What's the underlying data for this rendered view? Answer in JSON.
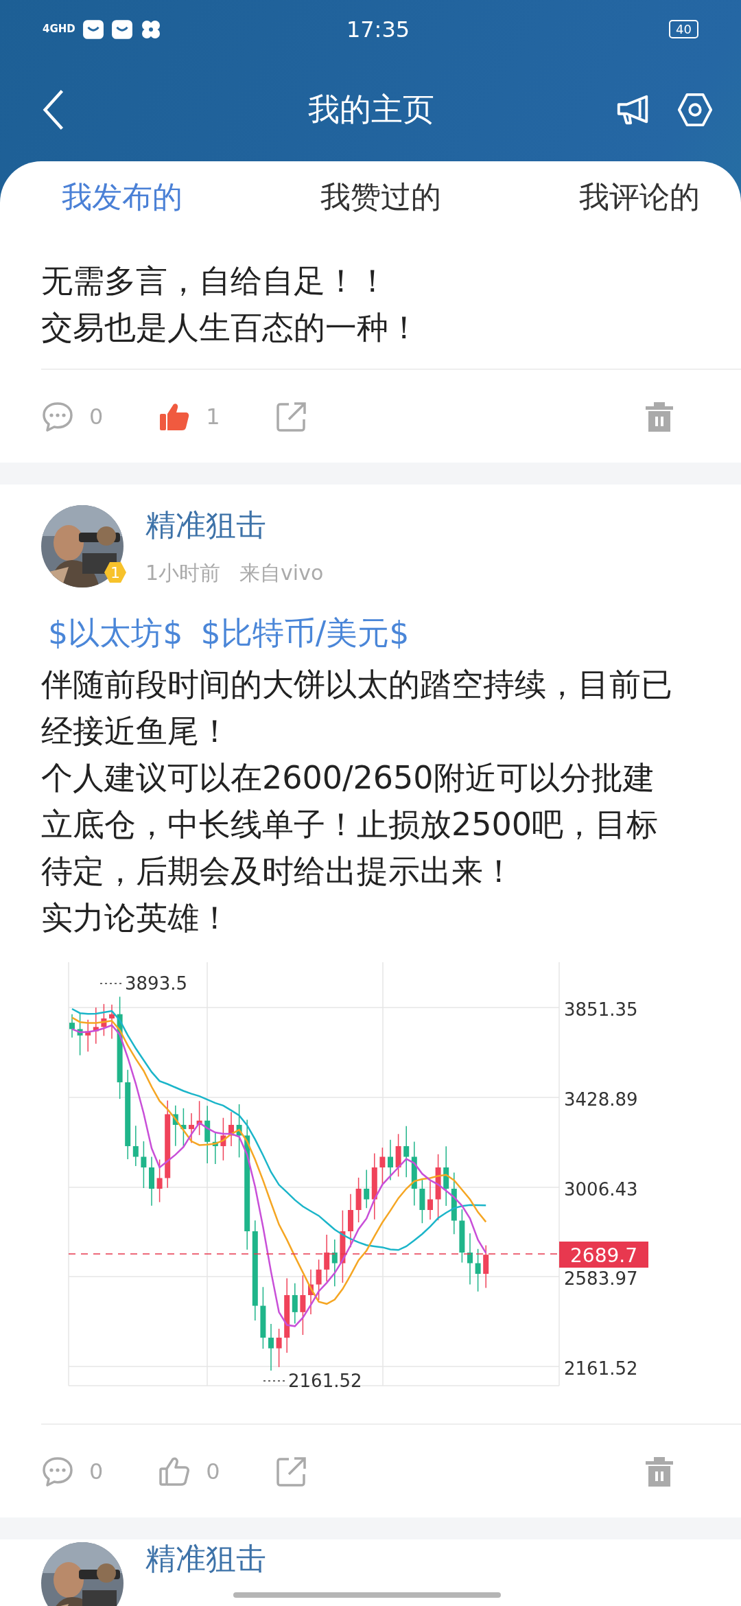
{
  "status_bar": {
    "network": "4GHD",
    "time": "17:35",
    "battery": "40"
  },
  "header": {
    "title": "我的主页"
  },
  "tabs": [
    {
      "label": "我发布的",
      "selected": true
    },
    {
      "label": "我赞过的",
      "selected": false
    },
    {
      "label": "我评论的",
      "selected": false
    }
  ],
  "posts": [
    {
      "kind": "partial",
      "paragraphs": [
        [
          "无需多言，自给自足！！"
        ],
        [
          "交易也是人生百态的一种！"
        ]
      ],
      "actions": {
        "comments": "0",
        "likes": "1",
        "liked": true
      }
    },
    {
      "kind": "full",
      "author": "精准狙击",
      "level_badge": "1",
      "time": "1小时前",
      "source": "来自vivo",
      "tags": [
        "$以太坊$",
        "$比特币/美元$"
      ],
      "paragraphs": [
        [
          "伴随前段时间的大饼以太的踏空持续，目前已",
          "经接近鱼尾！"
        ],
        [
          "个人建议可以在2600/2650附近可以分批建",
          "立底仓，中长线单子！止损放2500吧，目标",
          "待定，后期会及时给出提示出来！"
        ],
        [
          "实力论英雄！"
        ]
      ],
      "chart": {
        "y_labels": [
          "3851.35",
          "3428.89",
          "3006.43",
          "2583.97",
          "2161.52"
        ],
        "high_label": "3893.5",
        "low_label": "2161.52",
        "last_price": "2689.7"
      },
      "actions": {
        "comments": "0",
        "likes": "0",
        "liked": false
      }
    },
    {
      "kind": "cut",
      "author": "精准狙击"
    }
  ]
}
